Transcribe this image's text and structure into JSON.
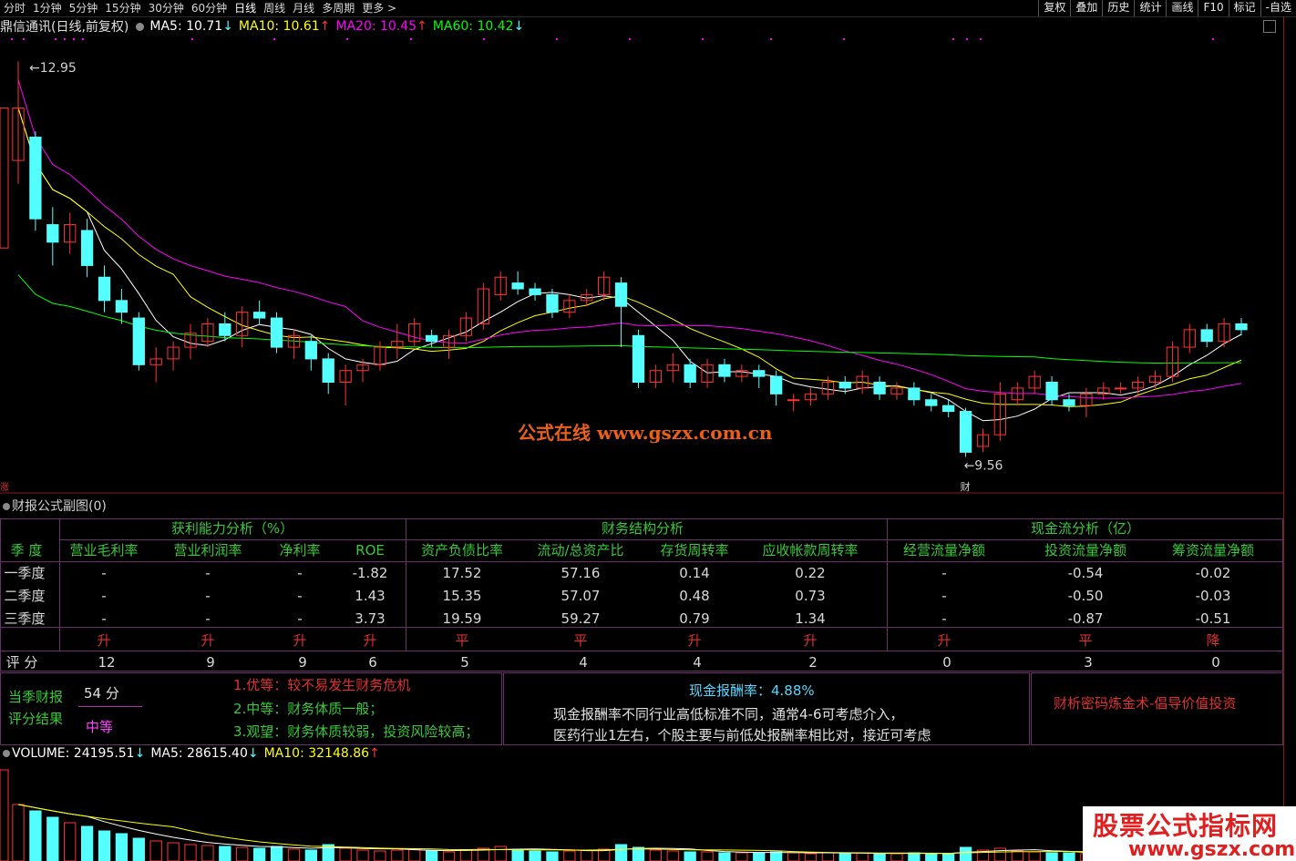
{
  "toolbar": {
    "periods": [
      "分时",
      "1分钟",
      "5分钟",
      "15分钟",
      "30分钟",
      "60分钟",
      "日线",
      "周线",
      "月线",
      "多周期",
      "更多 >"
    ],
    "active_period": "日线",
    "right_buttons": [
      "复权",
      "叠加",
      "历史",
      "统计",
      "画线",
      "F10",
      "标记",
      "-自选"
    ]
  },
  "header": {
    "stock_title": "鼎信通讯(日线,前复权)",
    "ma5": "MA5: 10.71",
    "ma10": "MA10: 10.61",
    "ma20": "MA20: 10.45",
    "ma60": "MA60: 10.42",
    "arrow_down": "↓",
    "arrow_up": "↑"
  },
  "colors": {
    "up": "#ff3232",
    "down": "#54ffff",
    "ma5": "#ffffff",
    "ma10": "#ffff00",
    "ma20": "#ff00ff",
    "ma60": "#00ff00",
    "grid": "#6b2f6b",
    "watermark": "#e8601c"
  },
  "main_chart": {
    "high_label": "12.95",
    "low_label": "9.56",
    "high_price": 12.95,
    "low_price": 9.56,
    "zhang_label": "涨",
    "cai_label": "财",
    "watermark": "公式在线  www.gszx.com.cn"
  },
  "chart_data": {
    "type": "candlestick",
    "candles": [
      [
        12.1,
        12.55,
        11.9,
        12.95
      ],
      [
        12.3,
        11.6,
        11.5,
        12.35
      ],
      [
        11.55,
        11.4,
        11.2,
        11.7
      ],
      [
        11.4,
        11.55,
        11.3,
        11.65
      ],
      [
        11.5,
        11.2,
        11.1,
        11.6
      ],
      [
        11.1,
        10.9,
        10.8,
        11.2
      ],
      [
        10.9,
        10.8,
        10.7,
        11.0
      ],
      [
        10.75,
        10.35,
        10.3,
        10.8
      ],
      [
        10.35,
        10.4,
        10.2,
        10.5
      ],
      [
        10.4,
        10.5,
        10.3,
        10.55
      ],
      [
        10.5,
        10.62,
        10.4,
        10.7
      ],
      [
        10.55,
        10.7,
        10.5,
        10.75
      ],
      [
        10.7,
        10.6,
        10.55,
        10.8
      ],
      [
        10.6,
        10.8,
        10.5,
        10.85
      ],
      [
        10.8,
        10.75,
        10.7,
        10.9
      ],
      [
        10.75,
        10.5,
        10.45,
        10.8
      ],
      [
        10.5,
        10.6,
        10.4,
        10.65
      ],
      [
        10.55,
        10.4,
        10.3,
        10.6
      ],
      [
        10.4,
        10.2,
        10.1,
        10.45
      ],
      [
        10.2,
        10.3,
        10.0,
        10.35
      ],
      [
        10.3,
        10.35,
        10.2,
        10.4
      ],
      [
        10.35,
        10.5,
        10.3,
        10.55
      ],
      [
        10.5,
        10.55,
        10.4,
        10.7
      ],
      [
        10.55,
        10.7,
        10.5,
        10.75
      ],
      [
        10.6,
        10.55,
        10.5,
        10.65
      ],
      [
        10.5,
        10.6,
        10.4,
        10.65
      ],
      [
        10.6,
        10.75,
        10.55,
        10.8
      ],
      [
        10.7,
        11.0,
        10.65,
        11.05
      ],
      [
        10.95,
        11.1,
        10.9,
        11.15
      ],
      [
        11.05,
        11.0,
        10.95,
        11.15
      ],
      [
        11.0,
        10.95,
        10.9,
        11.05
      ],
      [
        10.95,
        10.8,
        10.75,
        11.0
      ],
      [
        10.8,
        10.9,
        10.75,
        10.95
      ],
      [
        10.9,
        10.95,
        10.85,
        11.0
      ],
      [
        10.95,
        11.1,
        10.9,
        11.15
      ],
      [
        11.05,
        10.85,
        10.5,
        11.1
      ],
      [
        10.6,
        10.2,
        10.15,
        10.65
      ],
      [
        10.2,
        10.3,
        10.15,
        10.35
      ],
      [
        10.3,
        10.35,
        10.2,
        10.45
      ],
      [
        10.35,
        10.2,
        10.15,
        10.4
      ],
      [
        10.2,
        10.35,
        10.15,
        10.4
      ],
      [
        10.35,
        10.25,
        10.2,
        10.4
      ],
      [
        10.25,
        10.3,
        10.2,
        10.35
      ],
      [
        10.3,
        10.25,
        10.15,
        10.35
      ],
      [
        10.25,
        10.1,
        10.0,
        10.3
      ],
      [
        10.05,
        10.05,
        9.95,
        10.1
      ],
      [
        10.05,
        10.1,
        10.0,
        10.15
      ],
      [
        10.1,
        10.2,
        10.05,
        10.25
      ],
      [
        10.2,
        10.15,
        10.1,
        10.25
      ],
      [
        10.15,
        10.25,
        10.1,
        10.3
      ],
      [
        10.2,
        10.1,
        10.05,
        10.25
      ],
      [
        10.1,
        10.15,
        10.05,
        10.2
      ],
      [
        10.15,
        10.05,
        10.0,
        10.2
      ],
      [
        10.05,
        10.0,
        9.95,
        10.1
      ],
      [
        10.0,
        9.95,
        9.9,
        10.05
      ],
      [
        9.95,
        9.6,
        9.56,
        9.98
      ],
      [
        9.65,
        9.75,
        9.6,
        9.8
      ],
      [
        9.75,
        10.1,
        9.7,
        10.2
      ],
      [
        10.05,
        10.15,
        10.0,
        10.2
      ],
      [
        10.15,
        10.25,
        10.1,
        10.3
      ],
      [
        10.2,
        10.05,
        10.0,
        10.25
      ],
      [
        10.05,
        10.0,
        9.95,
        10.1
      ],
      [
        10.0,
        10.1,
        9.9,
        10.15
      ],
      [
        10.1,
        10.15,
        10.05,
        10.2
      ],
      [
        10.15,
        10.15,
        10.1,
        10.2
      ],
      [
        10.15,
        10.2,
        10.1,
        10.25
      ],
      [
        10.2,
        10.25,
        10.15,
        10.3
      ],
      [
        10.25,
        10.5,
        10.2,
        10.55
      ],
      [
        10.5,
        10.65,
        10.45,
        10.7
      ],
      [
        10.65,
        10.55,
        10.5,
        10.7
      ],
      [
        10.55,
        10.7,
        10.5,
        10.75
      ],
      [
        10.7,
        10.65,
        10.6,
        10.75
      ]
    ],
    "ylim": [
      9.4,
      13.1
    ]
  },
  "subchart": {
    "title": "财报公式副图(0)",
    "groups": [
      "获利能力分析（%）",
      "财务结构分析",
      "现金流分析（亿）"
    ],
    "season_header": "季 度",
    "columns": [
      "营业毛利率",
      "营业利润率",
      "净利率",
      "ROE",
      "资产负债比率",
      "流动/总资产比",
      "存货周转率",
      "应收帐款周转率",
      "经营流量净额",
      "投资流量净额",
      "筹资流量净额"
    ],
    "rows": [
      {
        "label": "一季度",
        "values": [
          "-",
          "-",
          "-",
          "-1.82",
          "17.52",
          "57.16",
          "0.14",
          "0.22",
          "-",
          "-0.54",
          "-0.02"
        ]
      },
      {
        "label": "二季度",
        "values": [
          "-",
          "-",
          "-",
          "1.43",
          "15.35",
          "57.07",
          "0.48",
          "0.73",
          "-",
          "-0.50",
          "-0.03"
        ]
      },
      {
        "label": "三季度",
        "values": [
          "-",
          "-",
          "-",
          "3.73",
          "19.59",
          "59.27",
          "0.79",
          "1.34",
          "-",
          "-0.87",
          "-0.51"
        ]
      }
    ],
    "trend": [
      "升",
      "升",
      "升",
      "升",
      "平",
      "平",
      "升",
      "升",
      "升",
      "平",
      "降"
    ],
    "score_label": "评 分",
    "scores": [
      "12",
      "9",
      "9",
      "6",
      "5",
      "4",
      "4",
      "2",
      "0",
      "3",
      "0"
    ]
  },
  "summary": {
    "label_line1": "当季财报",
    "label_line2": "评分结果",
    "score": "54  分",
    "grade": "中等",
    "legend1": "1.优等：较不易发生财务危机",
    "legend2": "2.中等：财务体质一般；",
    "legend3": "3.观望：财务体质较弱，投资风险较高；",
    "cash_ratio": "现金报酬率：4.88%",
    "cash_note1": "现金报酬率不同行业高低标准不同，通常4-6可考虑介入，",
    "cash_note2": "医药行业1左右，个股主要与前低处报酬率相比对，接近可考虑",
    "slogan": "财析密码炼金术-倡导价值投资"
  },
  "volume": {
    "vol": "VOLUME: 24195.51",
    "ma5": "MA5: 28615.40",
    "ma10": "MA10: 32148.86",
    "watermark_title": "股票公式指标网",
    "watermark_url": "www.gszx.com.cn"
  }
}
